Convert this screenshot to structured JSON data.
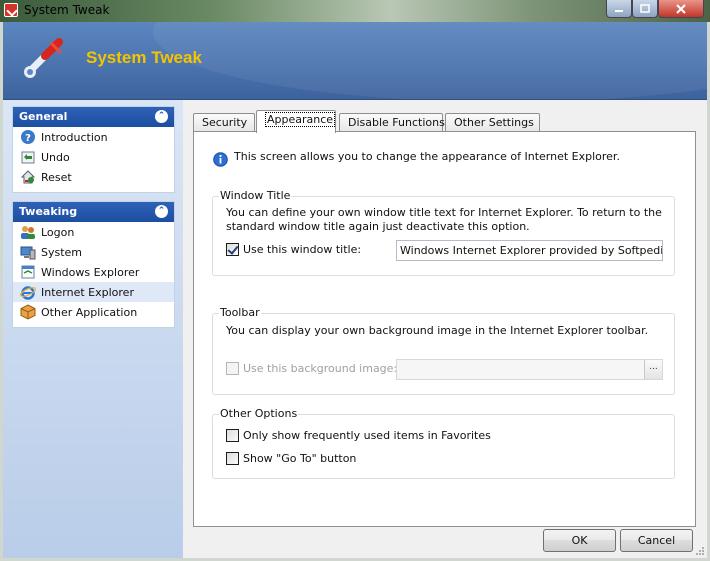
{
  "window": {
    "title": "System Tweak",
    "controls": [
      "minimize",
      "maximize",
      "close"
    ]
  },
  "header": {
    "title": "System Tweak",
    "logo_icon": "wrench-icon",
    "title_color": "#f4c400"
  },
  "sidebar": {
    "groups": [
      {
        "title": "General",
        "items": [
          {
            "label": "Introduction",
            "icon": "help-icon"
          },
          {
            "label": "Undo",
            "icon": "undo-icon"
          },
          {
            "label": "Reset",
            "icon": "reset-icon"
          }
        ]
      },
      {
        "title": "Tweaking",
        "items": [
          {
            "label": "Logon",
            "icon": "users-icon"
          },
          {
            "label": "System",
            "icon": "system-icon"
          },
          {
            "label": "Windows Explorer",
            "icon": "explorer-icon"
          },
          {
            "label": "Internet Explorer",
            "icon": "ie-icon",
            "selected": true
          },
          {
            "label": "Other Application",
            "icon": "package-icon"
          }
        ]
      }
    ]
  },
  "tabs": [
    {
      "label": "Security",
      "active": false
    },
    {
      "label": "Appearance",
      "active": true
    },
    {
      "label": "Disable Functions",
      "active": false
    },
    {
      "label": "Other Settings",
      "active": false
    }
  ],
  "content": {
    "intro": "This screen allows you to change the appearance of Internet Explorer.",
    "window_title": {
      "legend": "Window Title",
      "description": "You can define your own window title text for Internet Explorer. To return to the standard window title again just deactivate this option.",
      "checkbox_label": "Use this window title:",
      "checked": true,
      "value": "Windows Internet Explorer provided by Softpedia"
    },
    "toolbar": {
      "legend": "Toolbar",
      "description": "You can display your own background image in the Internet Explorer toolbar.",
      "checkbox_label": "Use this background image:",
      "checked": false,
      "enabled": false,
      "value": "",
      "browse_label": "..."
    },
    "other_options": {
      "legend": "Other Options",
      "options": [
        {
          "label": "Only show frequently used items in Favorites",
          "checked": false
        },
        {
          "label": "Show \"Go To\" button",
          "checked": false
        }
      ]
    }
  },
  "buttons": {
    "ok": "OK",
    "cancel": "Cancel"
  }
}
